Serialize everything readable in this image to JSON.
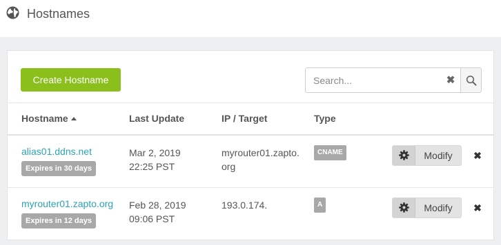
{
  "header": {
    "title": "Hostnames",
    "icon": "globe-icon"
  },
  "toolbar": {
    "create_label": "Create Hostname"
  },
  "search": {
    "placeholder": "Search...",
    "value": "",
    "clear_icon": "close-icon",
    "search_icon": "search-icon"
  },
  "table": {
    "columns": {
      "hostname": "Hostname",
      "last_update": "Last Update",
      "ip_target": "IP / Target",
      "type": "Type"
    },
    "sort": {
      "column": "hostname",
      "direction": "ascending"
    },
    "rows": [
      {
        "hostname": "alias01.ddns.net",
        "expires": "Expires in 30 days",
        "last_update_date": "Mar 2, 2019",
        "last_update_time": "22:25 PST",
        "ip_target": "myrouter01.zapto.org",
        "type": "CNAME",
        "modify_label": "Modify"
      },
      {
        "hostname": "myrouter01.zapto.org",
        "expires": "Expires in 12 days",
        "last_update_date": "Feb 28, 2019",
        "last_update_time": "09:06 PST",
        "ip_target": "193.0.174.",
        "type": "A",
        "modify_label": "Modify"
      }
    ]
  },
  "colors": {
    "primary_button": "#8bbf1c",
    "link": "#2ba3b5",
    "badge": "#a8a8a8"
  }
}
